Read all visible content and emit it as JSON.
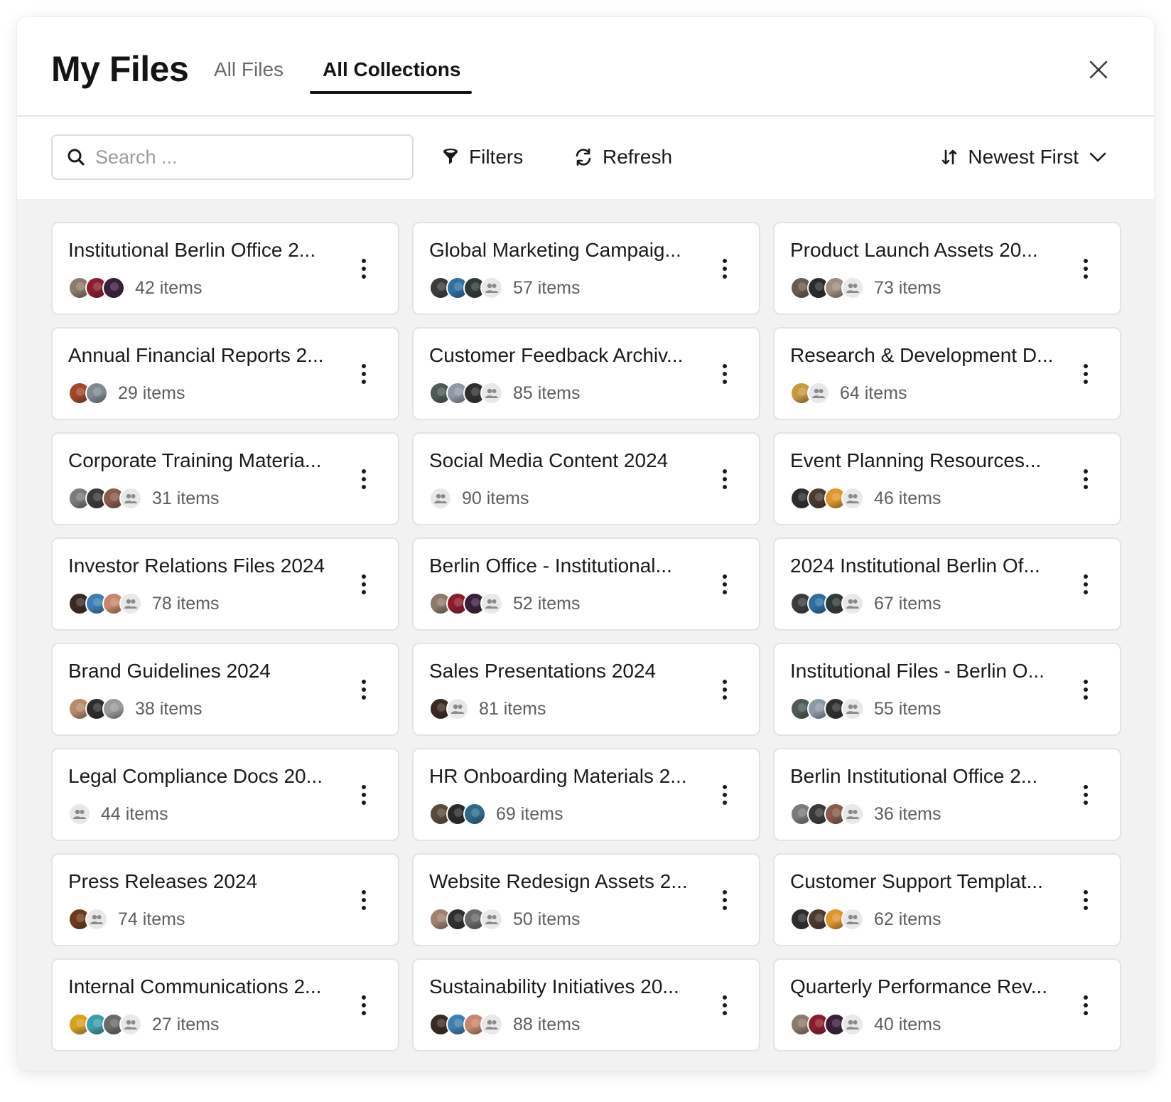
{
  "header": {
    "title": "My Files",
    "tabs": [
      {
        "label": "All Files",
        "active": false
      },
      {
        "label": "All Collections",
        "active": true
      }
    ]
  },
  "toolbar": {
    "search_placeholder": "Search ...",
    "filters_label": "Filters",
    "refresh_label": "Refresh",
    "sort_label": "Newest First"
  },
  "icons": {
    "search": "search-icon",
    "filters": "filter-icon",
    "refresh": "refresh-icon",
    "sort": "sort-icon",
    "sort_dropdown": "chevron-down-icon",
    "close": "close-icon",
    "more": "more-vertical-icon",
    "group": "users-icon"
  },
  "colors": {
    "accent": "#141414",
    "grid_background": "#f2f2f2",
    "card_border": "#e3e3e3",
    "muted_text": "#5e5e5e"
  },
  "collections": [
    {
      "title": "Institutional Berlin Office 2...",
      "count": "42 items",
      "avatars": [
        "#8c7a6b",
        "#8b1c2c",
        "#3a1f3a"
      ],
      "group": false
    },
    {
      "title": "Global Marketing Campaig...",
      "count": "57 items",
      "avatars": [
        "#3b3b3b",
        "#2d6fa3",
        "#2f3a36"
      ],
      "group": true
    },
    {
      "title": "Product Launch Assets 20...",
      "count": "73 items",
      "avatars": [
        "#6a5a4d",
        "#2b2b2b",
        "#a08c80"
      ],
      "group": true
    },
    {
      "title": "Annual Financial Reports 2...",
      "count": "29 items",
      "avatars": [
        "#a3452a",
        "#7d8a94"
      ],
      "group": false
    },
    {
      "title": "Customer Feedback Archiv...",
      "count": "85 items",
      "avatars": [
        "#4d5a55",
        "#8d9aa6",
        "#2f2f2f"
      ],
      "group": true
    },
    {
      "title": "Research & Development D...",
      "count": "64 items",
      "avatars": [
        "#c69a3c"
      ],
      "group": true
    },
    {
      "title": "Corporate Training Materia...",
      "count": "31 items",
      "avatars": [
        "#7a7a7a",
        "#3a3a3a",
        "#8a5a4a"
      ],
      "group": true
    },
    {
      "title": "Social Media Content 2024",
      "count": "90 items",
      "avatars": [],
      "group": true
    },
    {
      "title": "Event Planning Resources...",
      "count": "46 items",
      "avatars": [
        "#2d2d2d",
        "#4a3a30",
        "#e0962c"
      ],
      "group": true
    },
    {
      "title": "Investor Relations Files 2024",
      "count": "78 items",
      "avatars": [
        "#3a2a22",
        "#3b7fb5",
        "#c9866a"
      ],
      "group": true
    },
    {
      "title": "Berlin Office - Institutional...",
      "count": "52 items",
      "avatars": [
        "#8c7a6b",
        "#8b1c2c",
        "#3a1f3a"
      ],
      "group": true
    },
    {
      "title": "2024 Institutional Berlin Of...",
      "count": "67 items",
      "avatars": [
        "#3b3b3b",
        "#2d6fa3",
        "#2f3a36"
      ],
      "group": true
    },
    {
      "title": "Brand Guidelines 2024",
      "count": "38 items",
      "avatars": [
        "#b88a6a",
        "#2d2d2d",
        "#9a9a9a"
      ],
      "group": false
    },
    {
      "title": "Sales Presentations 2024",
      "count": "81 items",
      "avatars": [
        "#3a2a22"
      ],
      "group": true
    },
    {
      "title": "Institutional Files - Berlin O...",
      "count": "55 items",
      "avatars": [
        "#4d5a55",
        "#8d9aa6",
        "#2f2f2f"
      ],
      "group": true
    },
    {
      "title": "Legal Compliance Docs 20...",
      "count": "44 items",
      "avatars": [],
      "group": true
    },
    {
      "title": "HR Onboarding Materials 2...",
      "count": "69 items",
      "avatars": [
        "#5a4a3a",
        "#2a2a2a",
        "#2d6a8a"
      ],
      "group": false
    },
    {
      "title": "Berlin Institutional Office 2...",
      "count": "36 items",
      "avatars": [
        "#7a7a7a",
        "#3a3a3a",
        "#8a5a4a"
      ],
      "group": true
    },
    {
      "title": "Press Releases 2024",
      "count": "74 items",
      "avatars": [
        "#6a3a1a"
      ],
      "group": true
    },
    {
      "title": "Website Redesign Assets 2...",
      "count": "50 items",
      "avatars": [
        "#a08070",
        "#2f2f2f",
        "#6a6a6a"
      ],
      "group": true
    },
    {
      "title": "Customer Support Templat...",
      "count": "62 items",
      "avatars": [
        "#2d2d2d",
        "#4a3a30",
        "#e0962c"
      ],
      "group": true
    },
    {
      "title": "Internal Communications 2...",
      "count": "27 items",
      "avatars": [
        "#d9a020",
        "#3aa0a8",
        "#6a6a6a"
      ],
      "group": true
    },
    {
      "title": "Sustainability Initiatives 20...",
      "count": "88 items",
      "avatars": [
        "#3a2a22",
        "#3b7fb5",
        "#c9866a"
      ],
      "group": true
    },
    {
      "title": "Quarterly Performance Rev...",
      "count": "40 items",
      "avatars": [
        "#8c7a6b",
        "#8b1c2c",
        "#3a1f3a"
      ],
      "group": true
    }
  ]
}
